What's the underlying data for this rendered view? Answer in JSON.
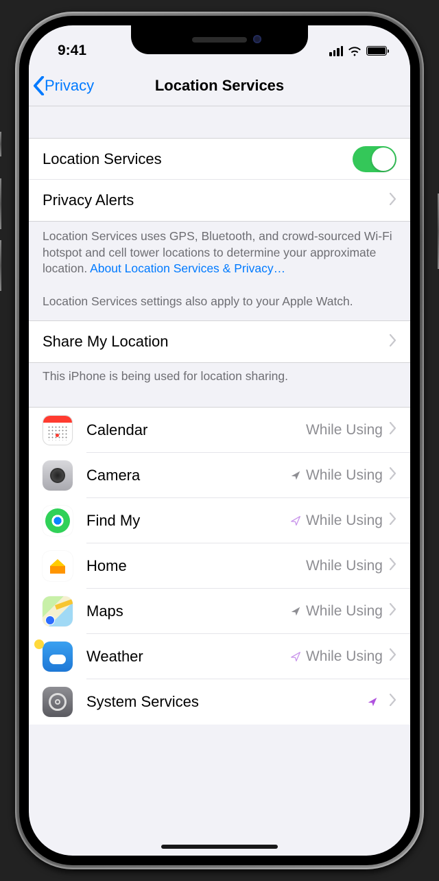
{
  "status": {
    "time": "9:41"
  },
  "nav": {
    "back": "Privacy",
    "title": "Location Services"
  },
  "main_toggle": {
    "label": "Location Services",
    "on": true
  },
  "privacy_alerts": {
    "label": "Privacy Alerts"
  },
  "explainer": {
    "line1": "Location Services uses GPS, Bluetooth, and crowd-sourced Wi-Fi hotspot and cell tower locations to determine your approximate location. ",
    "link": "About Location Services & Privacy…",
    "line2": "Location Services settings also apply to your Apple Watch."
  },
  "share": {
    "label": "Share My Location",
    "footer": "This iPhone is being used for location sharing."
  },
  "apps": [
    {
      "name": "Calendar",
      "value": "While Using",
      "arrow": null,
      "icon": "calendar"
    },
    {
      "name": "Camera",
      "value": "While Using",
      "arrow": "gray",
      "icon": "camera"
    },
    {
      "name": "Find My",
      "value": "While Using",
      "arrow": "purple-outline",
      "icon": "findmy"
    },
    {
      "name": "Home",
      "value": "While Using",
      "arrow": null,
      "icon": "home"
    },
    {
      "name": "Maps",
      "value": "While Using",
      "arrow": "gray",
      "icon": "maps"
    },
    {
      "name": "Weather",
      "value": "While Using",
      "arrow": "purple-outline",
      "icon": "weather"
    },
    {
      "name": "System Services",
      "value": "",
      "arrow": "purple-solid",
      "icon": "system"
    }
  ]
}
